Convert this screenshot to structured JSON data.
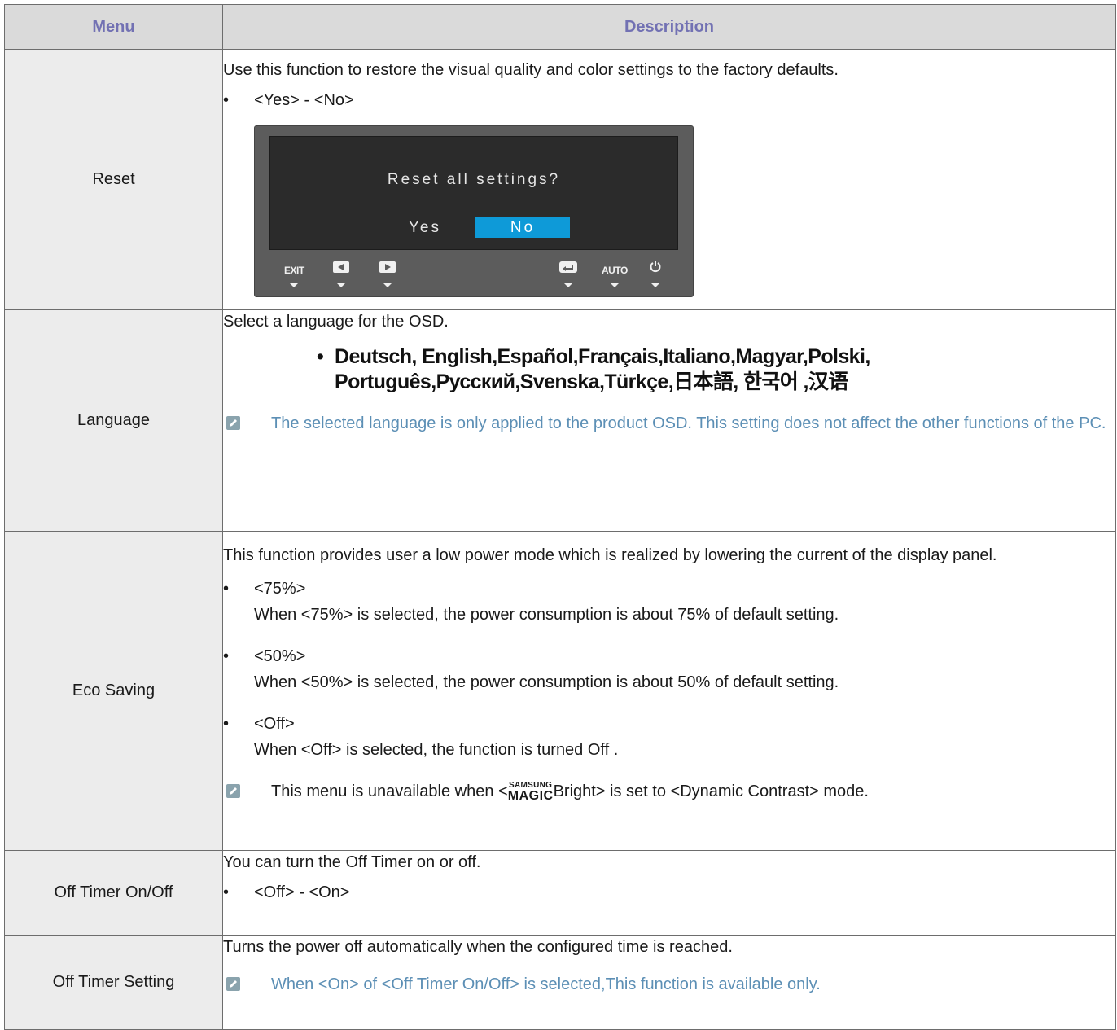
{
  "header": {
    "menu": "Menu",
    "description": "Description"
  },
  "rows": {
    "reset": {
      "menu": "Reset",
      "text": "Use this function to restore the visual quality and color settings to the factory defaults.",
      "bullet": "<Yes> - <No>",
      "osd": {
        "title": "Reset all settings?",
        "yes": "Yes",
        "no": "No",
        "buttons": {
          "exit": "EXIT",
          "auto": "AUTO"
        },
        "selected_color": "#0e9ad8"
      }
    },
    "language": {
      "menu": "Language",
      "text": "Select a language for the OSD.",
      "languages_line1": "Deutsch, English,Español,Français,Italiano,Magyar,Polski,",
      "languages_line2": "Português,Русский,Svenska,Türkçe,日本語, 한국어 ,汉语",
      "note": "The selected language is only applied to the product OSD. This setting does not affect the other functions of the PC."
    },
    "eco": {
      "menu": "Eco Saving",
      "text": "This function provides user a low power mode which is realized by lowering the current of the display panel.",
      "opt1": "<75%>",
      "opt1_desc": "When <75%> is selected, the power consumption is about 75% of default setting.",
      "opt2": "<50%>",
      "opt2_desc": "When <50%> is selected, the power consumption is about 50% of default setting.",
      "opt3": "<Off>",
      "opt3_desc": "When <Off> is selected, the function is turned Off .",
      "note_before": "This menu is unavailable when <",
      "logo_top": "SAMSUNG",
      "logo_bottom": "MAGIC",
      "note_after": "Bright> is set to <Dynamic Contrast> mode."
    },
    "off_timer": {
      "menu": "Off Timer On/Off",
      "text": "You can turn the Off Timer on or off.",
      "bullet": "<Off> - <On>"
    },
    "off_timer_setting": {
      "menu": "Off Timer Setting",
      "text": "Turns the power off automatically when the configured time is reached.",
      "note": "When <On> of <Off Timer On/Off> is selected,This function is available only."
    }
  },
  "colors": {
    "header_text": "#7271b3",
    "note_text": "#5c8fb5",
    "header_bg": "#dadada",
    "menu_bg": "#ececec"
  },
  "bullet_char": "•"
}
